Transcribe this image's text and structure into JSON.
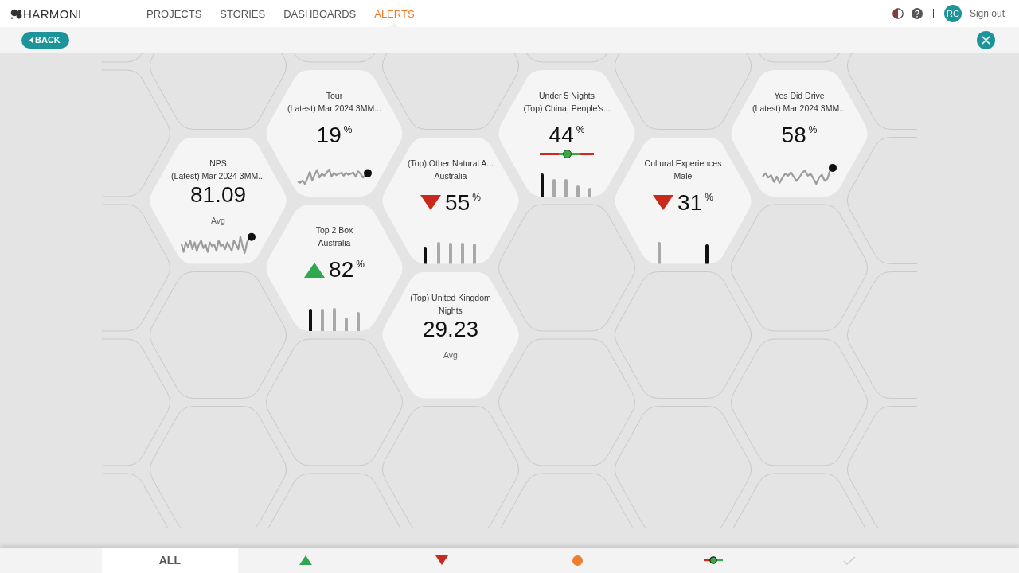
{
  "header": {
    "logo": "HARMONI",
    "nav": [
      {
        "label": "PROJECTS",
        "selected": false
      },
      {
        "label": "STORIES",
        "selected": false
      },
      {
        "label": "DASHBOARDS",
        "selected": false
      },
      {
        "label": "ALERTS",
        "selected": true
      }
    ],
    "user_initials": "RC",
    "sign_out": "Sign out"
  },
  "toolbar": {
    "back": "BACK"
  },
  "tiles": [
    {
      "title": "NPS",
      "subtitle": "(Latest) Mar 2024 3MM...",
      "value": "81.09",
      "note": "Avg",
      "chart": {
        "kind": "sparkline"
      }
    },
    {
      "title": "Tour",
      "subtitle": "(Latest) Mar 2024 3MM...",
      "value": "19",
      "unit": "%",
      "chart": {
        "kind": "sparkline"
      }
    },
    {
      "title": "Top 2 Box",
      "subtitle": "Australia",
      "trend": {
        "kind": "up"
      },
      "value": "82",
      "unit": "%",
      "chart": {
        "kind": "bars"
      }
    },
    {
      "title": "(Top) Other Natural A...",
      "subtitle": "Australia",
      "trend": {
        "kind": "down"
      },
      "value": "55",
      "unit": "%",
      "chart": {
        "kind": "bars"
      }
    },
    {
      "title": "(Top) United Kingdom",
      "subtitle": "Nights",
      "value": "29.23",
      "note": "Avg"
    },
    {
      "title": "Under 5 Nights",
      "subtitle": "(Top) China, People's...",
      "value": "44",
      "unit": "%",
      "gauge": {
        "level": 0.5
      },
      "chart": {
        "kind": "bars"
      }
    },
    {
      "title": "Cultural Experiences",
      "subtitle": "Male",
      "trend": {
        "kind": "down"
      },
      "value": "31",
      "unit": "%",
      "chart": {
        "kind": "bars"
      }
    },
    {
      "title": "Yes Did Drive",
      "subtitle": "(Latest) Mar 2024 3MM...",
      "value": "58",
      "unit": "%",
      "chart": {
        "kind": "sparkline"
      }
    }
  ],
  "filters": [
    {
      "kind": "all",
      "label": "ALL",
      "selected": true
    },
    {
      "kind": "up",
      "selected": false
    },
    {
      "kind": "down",
      "selected": false
    },
    {
      "kind": "dot",
      "selected": false
    },
    {
      "kind": "range",
      "selected": false
    },
    {
      "kind": "check",
      "selected": false
    }
  ]
}
